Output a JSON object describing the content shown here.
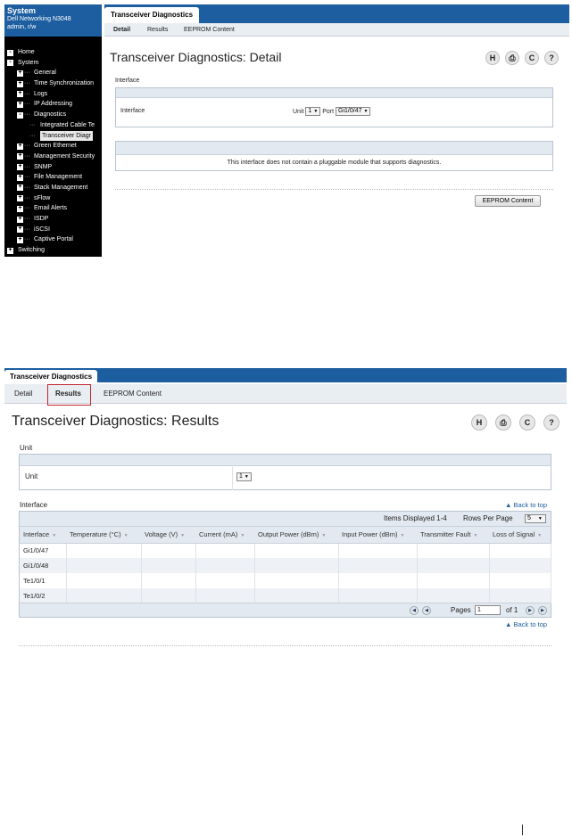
{
  "detail": {
    "sidebar": {
      "title": "System",
      "model": "Dell Networking N3048",
      "user": "admin, r/w",
      "tree": [
        {
          "label": "Home",
          "level": 0,
          "box": "-"
        },
        {
          "label": "System",
          "level": 0,
          "box": "-"
        },
        {
          "label": "General",
          "level": 1,
          "box": "+"
        },
        {
          "label": "Time Synchronization",
          "level": 1,
          "box": "+"
        },
        {
          "label": "Logs",
          "level": 1,
          "box": "+"
        },
        {
          "label": "IP Addressing",
          "level": 1,
          "box": "+"
        },
        {
          "label": "Diagnostics",
          "level": 1,
          "box": "-"
        },
        {
          "label": "Integrated Cable Te",
          "level": 2,
          "box": ""
        },
        {
          "label": "Transceiver Diagr",
          "level": 2,
          "box": "",
          "selected": true
        },
        {
          "label": "Green Ethernet",
          "level": 1,
          "box": "+"
        },
        {
          "label": "Management Security",
          "level": 1,
          "box": "+"
        },
        {
          "label": "SNMP",
          "level": 1,
          "box": "+"
        },
        {
          "label": "File Management",
          "level": 1,
          "box": "+"
        },
        {
          "label": "Stack Management",
          "level": 1,
          "box": "+"
        },
        {
          "label": "sFlow",
          "level": 1,
          "box": "+"
        },
        {
          "label": "Email Alerts",
          "level": 1,
          "box": "+"
        },
        {
          "label": "ISDP",
          "level": 1,
          "box": "+"
        },
        {
          "label": "iSCSI",
          "level": 1,
          "box": "+"
        },
        {
          "label": "Captive Portal",
          "level": 1,
          "box": "+"
        },
        {
          "label": "Switching",
          "level": 0,
          "box": "+"
        }
      ]
    },
    "tab": "Transceiver Diagnostics",
    "subtabs": [
      "Detail",
      "Results",
      "EEPROM Content"
    ],
    "title": "Transceiver Diagnostics: Detail",
    "tools": [
      "H",
      "⎙",
      "C",
      "?"
    ],
    "interface_section": "Interface",
    "interface_label": "Interface",
    "unit_label": "Unit",
    "unit_value": "1",
    "port_label": "Port",
    "port_value": "Gi1/0/47",
    "message": "This interface does not contain a pluggable module that supports diagnostics.",
    "eeprom_button": "EEPROM Content"
  },
  "results": {
    "tab": "Transceiver Diagnostics",
    "subtabs": [
      "Detail",
      "Results",
      "EEPROM Content"
    ],
    "title": "Transceiver Diagnostics: Results",
    "tools": [
      "H",
      "⎙",
      "C",
      "?"
    ],
    "unit_section": "Unit",
    "unit_label": "Unit",
    "unit_value": "1",
    "interface_section": "Interface",
    "back_to_top": "Back to top",
    "items_displayed": "Items Displayed 1-4",
    "rows_per_page_label": "Rows Per Page",
    "rows_per_page_value": "5",
    "columns": [
      "Interface",
      "Temperature (°C)",
      "Voltage (V)",
      "Current (mA)",
      "Output Power (dBm)",
      "Input Power (dBm)",
      "Transmitter Fault",
      "Loss of Signal"
    ],
    "rows": [
      [
        "Gi1/0/47"
      ],
      [
        "Gi1/0/48"
      ],
      [
        "Te1/0/1"
      ],
      [
        "Te1/0/2"
      ]
    ],
    "pages_label": "Pages",
    "page_value": "1",
    "of_label": "of 1"
  },
  "colors": {
    "accent": "#1c5ea0",
    "highlight": "#c1272d"
  }
}
